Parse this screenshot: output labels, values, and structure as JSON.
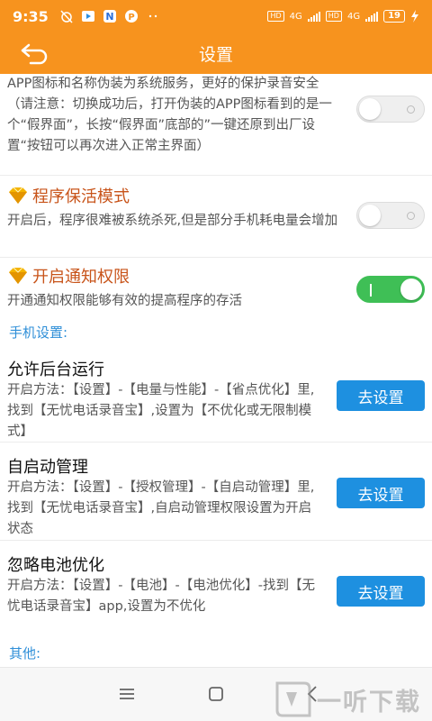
{
  "status_bar": {
    "time": "9:35",
    "signal1": "4G",
    "signal2": "4G",
    "battery": "19"
  },
  "app_bar": {
    "title": "设置"
  },
  "disguise": {
    "description": "APP图标和名称伪装为系统服务，更好的保护录音安全（请注意：切换成功后，打开伪装的APP图标看到的是一个“假界面”，长按“假界面”底部的”一键还原到出厂设置“按钮可以再次进入正常主界面）",
    "enabled": false
  },
  "keep_alive": {
    "title": "程序保活模式",
    "description": "开启后，程序很难被系统杀死,但是部分手机耗电量会增加",
    "enabled": false
  },
  "notification": {
    "title": "开启通知权限",
    "description": "开通通知权限能够有效的提高程序的存活",
    "enabled": true
  },
  "phone_settings": {
    "section_label": "手机设置:",
    "items": [
      {
        "title": "允许后台运行",
        "description": "开启方法：【设置】-【电量与性能】-【省点优化】里,找到【无忧电话录音宝】,设置为【不优化或无限制模式】",
        "button": "去设置"
      },
      {
        "title": "自启动管理",
        "description": "开启方法：【设置】-【授权管理】-【自启动管理】里,找到【无忧电话录音宝】,自启动管理权限设置为开启状态",
        "button": "去设置"
      },
      {
        "title": "忽略电池优化",
        "description": "开启方法：【设置】-【电池】-【电池优化】-找到【无忧电话录音宝】app,设置为不优化",
        "button": "去设置"
      }
    ]
  },
  "other": {
    "section_label": "其他:"
  },
  "watermark": {
    "text": "一听下载"
  },
  "colors": {
    "primary": "#f7931e",
    "accent_blue": "#1e90e0",
    "feature_title": "#c8541a",
    "toggle_on": "#3fbf56",
    "section": "#2f8fd8"
  }
}
